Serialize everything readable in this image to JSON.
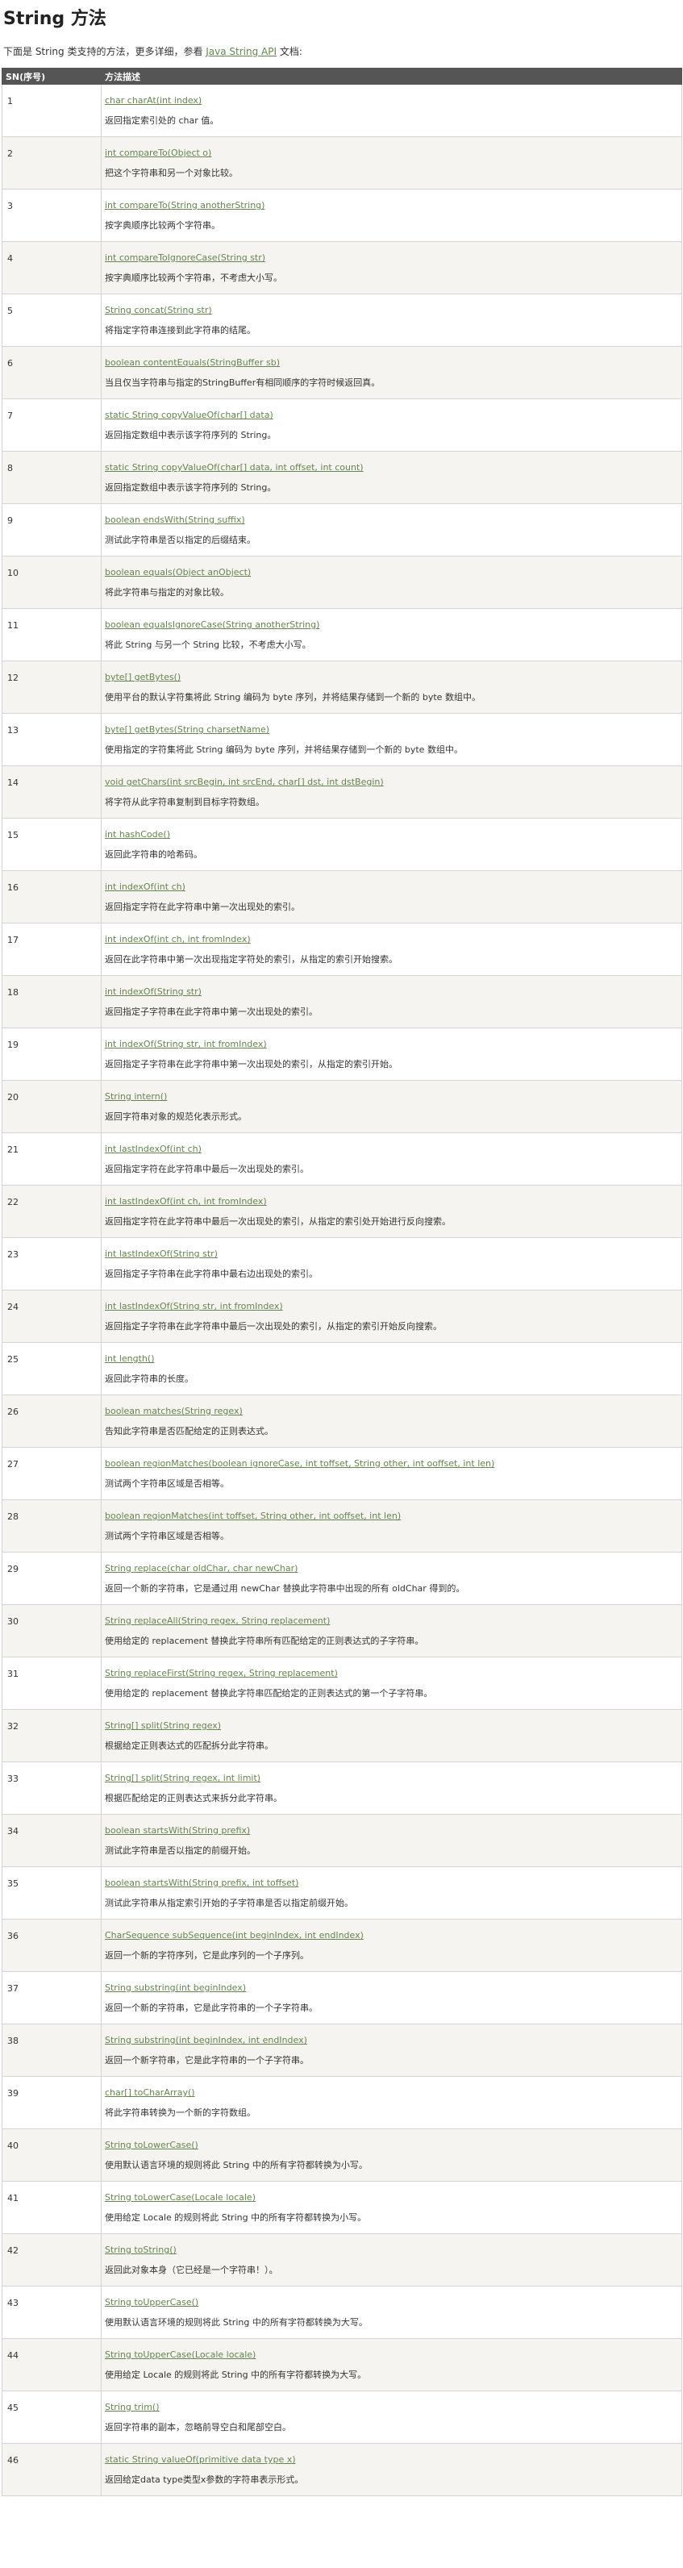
{
  "page": {
    "title": "String 方法",
    "intro_prefix": "下面是 String 类支持的方法，更多详细，参看 ",
    "intro_link": "Java String API",
    "intro_suffix": " 文档:"
  },
  "table": {
    "headers": [
      "SN(序号)",
      "方法描述"
    ],
    "rows": [
      {
        "num": "1",
        "sig": "char charAt(int index)",
        "desc": "返回指定索引处的 char 值。"
      },
      {
        "num": "2",
        "sig": "int compareTo(Object o)",
        "desc": "把这个字符串和另一个对象比较。"
      },
      {
        "num": "3",
        "sig": "int compareTo(String anotherString)",
        "desc": "按字典顺序比较两个字符串。"
      },
      {
        "num": "4",
        "sig": "int compareToIgnoreCase(String str)",
        "desc": "按字典顺序比较两个字符串，不考虑大小写。"
      },
      {
        "num": "5",
        "sig": "String concat(String str)",
        "desc": "将指定字符串连接到此字符串的结尾。"
      },
      {
        "num": "6",
        "sig": "boolean contentEquals(StringBuffer sb)",
        "desc": "当且仅当字符串与指定的StringBuffer有相同顺序的字符时候返回真。"
      },
      {
        "num": "7",
        "sig": "static String copyValueOf(char[] data)",
        "desc": "返回指定数组中表示该字符序列的 String。"
      },
      {
        "num": "8",
        "sig": "static String copyValueOf(char[] data, int offset, int count)",
        "desc": "返回指定数组中表示该字符序列的 String。"
      },
      {
        "num": "9",
        "sig": "boolean endsWith(String suffix)",
        "desc": "测试此字符串是否以指定的后缀结束。"
      },
      {
        "num": "10",
        "sig": "boolean equals(Object anObject)",
        "desc": "将此字符串与指定的对象比较。"
      },
      {
        "num": "11",
        "sig": "boolean equalsIgnoreCase(String anotherString)",
        "desc": "将此 String 与另一个 String 比较，不考虑大小写。"
      },
      {
        "num": "12",
        "sig": "byte[] getBytes()",
        "desc": " 使用平台的默认字符集将此 String 编码为 byte 序列，并将结果存储到一个新的 byte 数组中。"
      },
      {
        "num": "13",
        "sig": "byte[] getBytes(String charsetName)",
        "desc": "使用指定的字符集将此 String 编码为 byte 序列，并将结果存储到一个新的 byte 数组中。"
      },
      {
        "num": "14",
        "sig": "void getChars(int srcBegin, int srcEnd, char[] dst, int dstBegin)",
        "desc": "将字符从此字符串复制到目标字符数组。"
      },
      {
        "num": "15",
        "sig": "int hashCode()",
        "desc": "返回此字符串的哈希码。"
      },
      {
        "num": "16",
        "sig": "int indexOf(int ch)",
        "desc": "返回指定字符在此字符串中第一次出现处的索引。"
      },
      {
        "num": "17",
        "sig": "int indexOf(int ch, int fromIndex)",
        "desc": "返回在此字符串中第一次出现指定字符处的索引，从指定的索引开始搜索。"
      },
      {
        "num": "18",
        "sig": "int indexOf(String str)",
        "desc": " 返回指定子字符串在此字符串中第一次出现处的索引。"
      },
      {
        "num": "19",
        "sig": "int indexOf(String str, int fromIndex)",
        "desc": "返回指定子字符串在此字符串中第一次出现处的索引，从指定的索引开始。"
      },
      {
        "num": "20",
        "sig": "String intern()",
        "desc": " 返回字符串对象的规范化表示形式。"
      },
      {
        "num": "21",
        "sig": "int lastIndexOf(int ch)",
        "desc": " 返回指定字符在此字符串中最后一次出现处的索引。"
      },
      {
        "num": "22",
        "sig": "int lastIndexOf(int ch, int fromIndex)",
        "desc": "返回指定字符在此字符串中最后一次出现处的索引，从指定的索引处开始进行反向搜索。"
      },
      {
        "num": "23",
        "sig": "int lastIndexOf(String str)",
        "desc": "返回指定子字符串在此字符串中最右边出现处的索引。"
      },
      {
        "num": "24",
        "sig": "int lastIndexOf(String str, int fromIndex)",
        "desc": " 返回指定子字符串在此字符串中最后一次出现处的索引，从指定的索引开始反向搜索。"
      },
      {
        "num": "25",
        "sig": "int length()",
        "desc": "返回此字符串的长度。"
      },
      {
        "num": "26",
        "sig": "boolean matches(String regex)",
        "desc": "告知此字符串是否匹配给定的正则表达式。"
      },
      {
        "num": "27",
        "sig": "boolean regionMatches(boolean ignoreCase, int toffset, String other, int ooffset, int len)",
        "desc": "测试两个字符串区域是否相等。"
      },
      {
        "num": "28",
        "sig": "boolean regionMatches(int toffset, String other, int ooffset, int len)",
        "desc": "测试两个字符串区域是否相等。"
      },
      {
        "num": "29",
        "sig": "String replace(char oldChar, char newChar)",
        "desc": "返回一个新的字符串，它是通过用 newChar 替换此字符串中出现的所有 oldChar 得到的。"
      },
      {
        "num": "30",
        "sig": "String replaceAll(String regex, String replacement)",
        "desc": "使用给定的 replacement 替换此字符串所有匹配给定的正则表达式的子字符串。"
      },
      {
        "num": "31",
        "sig": "String replaceFirst(String regex, String replacement)",
        "desc": " 使用给定的 replacement 替换此字符串匹配给定的正则表达式的第一个子字符串。"
      },
      {
        "num": "32",
        "sig": "String[] split(String regex)",
        "desc": "根据给定正则表达式的匹配拆分此字符串。"
      },
      {
        "num": "33",
        "sig": "String[] split(String regex, int limit)",
        "desc": "根据匹配给定的正则表达式来拆分此字符串。"
      },
      {
        "num": "34",
        "sig": "boolean startsWith(String prefix)",
        "desc": "测试此字符串是否以指定的前缀开始。"
      },
      {
        "num": "35",
        "sig": "boolean startsWith(String prefix, int toffset)",
        "desc": "测试此字符串从指定索引开始的子字符串是否以指定前缀开始。"
      },
      {
        "num": "36",
        "sig": "CharSequence subSequence(int beginIndex, int endIndex)",
        "desc": " 返回一个新的字符序列，它是此序列的一个子序列。"
      },
      {
        "num": "37",
        "sig": "String substring(int beginIndex)",
        "desc": "返回一个新的字符串，它是此字符串的一个子字符串。"
      },
      {
        "num": "38",
        "sig": "String substring(int beginIndex, int endIndex)",
        "desc": "返回一个新字符串，它是此字符串的一个子字符串。"
      },
      {
        "num": "39",
        "sig": "char[] toCharArray()",
        "desc": "将此字符串转换为一个新的字符数组。"
      },
      {
        "num": "40",
        "sig": "String toLowerCase()",
        "desc": "使用默认语言环境的规则将此 String 中的所有字符都转换为小写。"
      },
      {
        "num": "41",
        "sig": "String toLowerCase(Locale locale)",
        "desc": " 使用给定 Locale 的规则将此 String 中的所有字符都转换为小写。"
      },
      {
        "num": "42",
        "sig": "String toString()",
        "desc": " 返回此对象本身（它已经是一个字符串！）。"
      },
      {
        "num": "43",
        "sig": "String toUpperCase()",
        "desc": "使用默认语言环境的规则将此 String 中的所有字符都转换为大写。"
      },
      {
        "num": "44",
        "sig": "String toUpperCase(Locale locale)",
        "desc": "使用给定 Locale 的规则将此 String 中的所有字符都转换为大写。"
      },
      {
        "num": "45",
        "sig": "String trim()",
        "desc": "返回字符串的副本，忽略前导空白和尾部空白。"
      },
      {
        "num": "46",
        "sig": "static String valueOf(primitive data type x)",
        "desc": "返回给定data type类型x参数的字符串表示形式。"
      }
    ]
  }
}
